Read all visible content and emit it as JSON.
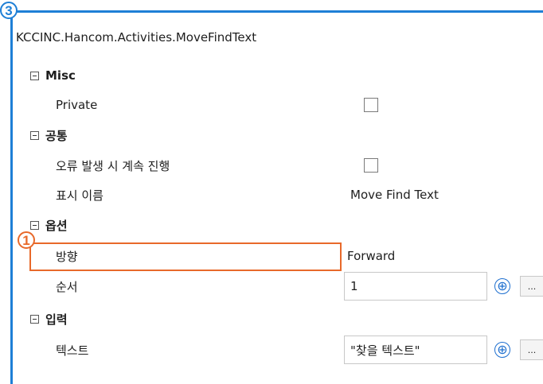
{
  "badges": {
    "frame": "3",
    "highlight": "1"
  },
  "header": {
    "class_name": "KCCINC.Hancom.Activities.MoveFindText"
  },
  "categories": {
    "misc": {
      "label": "Misc",
      "props": {
        "private": {
          "label": "Private",
          "checked": false
        }
      }
    },
    "common": {
      "label": "공통",
      "props": {
        "continue_on_error": {
          "label": "오류 발생 시 계속 진행",
          "checked": false
        },
        "display_name": {
          "label": "표시 이름",
          "value": "Move Find Text"
        }
      }
    },
    "options": {
      "label": "옵션",
      "props": {
        "direction": {
          "label": "방향",
          "value": "Forward"
        },
        "order": {
          "label": "순서",
          "value": "1"
        }
      }
    },
    "input": {
      "label": "입력",
      "props": {
        "text": {
          "label": "텍스트",
          "value": "\"찾을 텍스트\""
        }
      }
    }
  },
  "buttons": {
    "plus": "⊕",
    "more": "..."
  },
  "colors": {
    "frame": "#1e7fd6",
    "highlight": "#e8692a",
    "plus": "#1e6fcf"
  },
  "icons": {
    "collapse": "minus-square-icon",
    "plus": "plus-circle-icon"
  }
}
